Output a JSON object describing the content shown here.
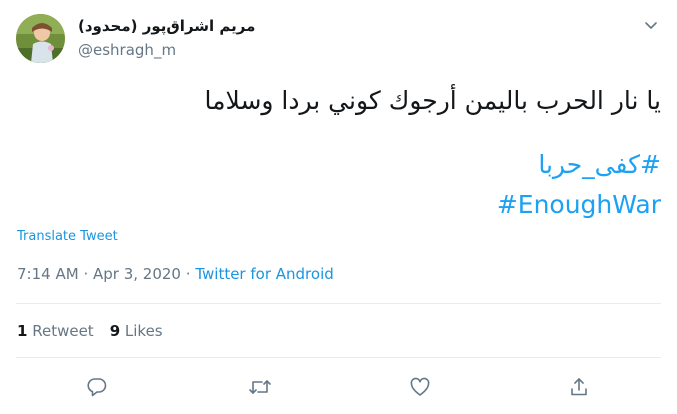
{
  "user": {
    "display_name": "مریم اشراق‌پور (محدود)",
    "handle": "@eshragh_m",
    "avatar_icon": "avatar-photo"
  },
  "tweet": {
    "text": "يا نار الحرب باليمن أرجوك كوني بردا وسلاما",
    "hashtags": [
      "#كفى_حربا",
      "#EnoughWar"
    ]
  },
  "translate_label": "Translate Tweet",
  "meta": {
    "time": "7:14 AM",
    "separator": "·",
    "date": "Apr 3, 2020",
    "source": "Twitter for Android"
  },
  "stats": {
    "retweets_count": "1",
    "retweets_label": "Retweet",
    "likes_count": "9",
    "likes_label": "Likes"
  },
  "actions": {
    "icons": [
      "reply-icon",
      "retweet-icon",
      "like-icon",
      "share-icon"
    ]
  },
  "colors": {
    "link": "#1da1f2",
    "muted": "#657786",
    "text": "#14171a",
    "divider": "#e6ecf0"
  }
}
